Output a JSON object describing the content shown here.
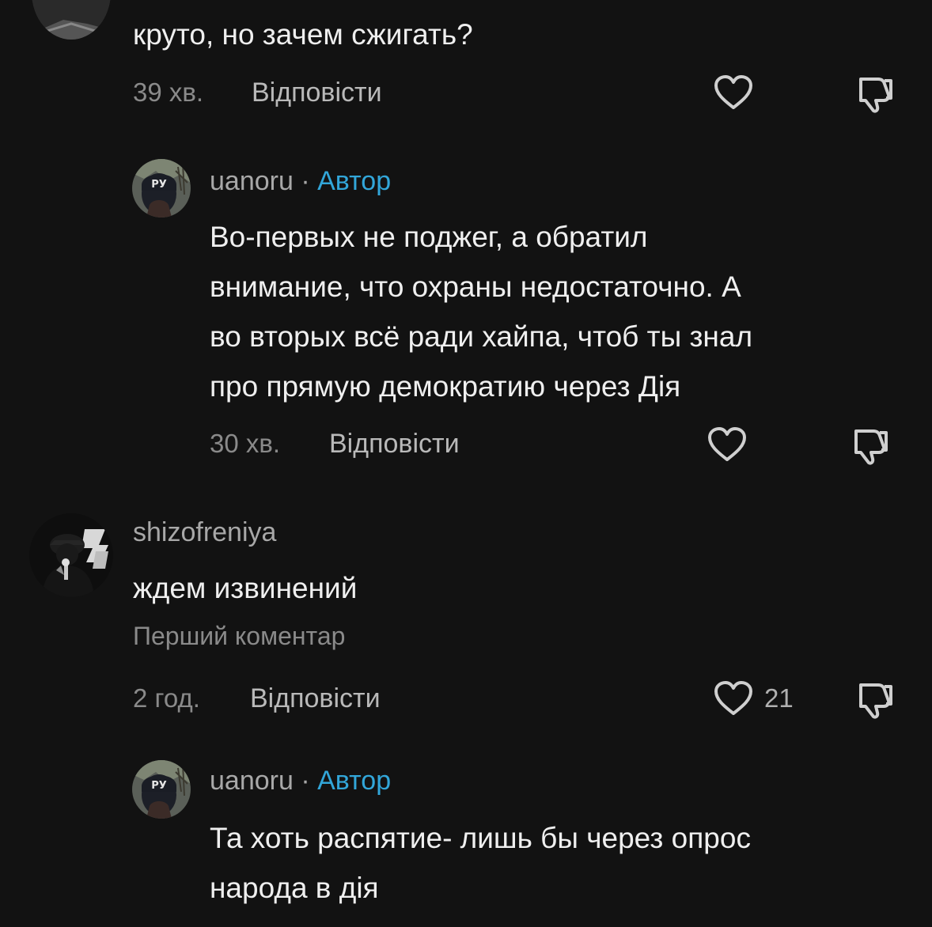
{
  "comments": [
    {
      "text": "круто, но зачем сжигать?",
      "time": "39 хв.",
      "reply_label": "Відповісти"
    },
    {
      "username": "uanoru",
      "separator": "·",
      "author_badge": "Автор",
      "text": "Во-первых не поджег, а обратил\nвнимание, что охраны недостаточно. А\nво вторых всё ради хайпа, чтоб ты знал\nпро прямую демократию через Дія",
      "time": "30 хв.",
      "reply_label": "Відповісти"
    },
    {
      "username": "shizofreniya",
      "text": "ждем извинений",
      "first_comment_label": "Перший коментар",
      "time": "2 год.",
      "reply_label": "Відповісти",
      "likes": "21"
    },
    {
      "username": "uanoru",
      "separator": "·",
      "author_badge": "Автор",
      "text": "Та хоть распятие- лишь бы через опрос\nнарода в дія"
    }
  ],
  "avatar_badge_text": "РУ",
  "colors": {
    "background": "#121212",
    "text": "#efefef",
    "muted": "#8a8a8a",
    "author_accent": "#32a6d9",
    "icon": "#cfcfcf"
  },
  "icons": {
    "like": "heart-icon",
    "dislike": "thumbs-down-icon"
  }
}
